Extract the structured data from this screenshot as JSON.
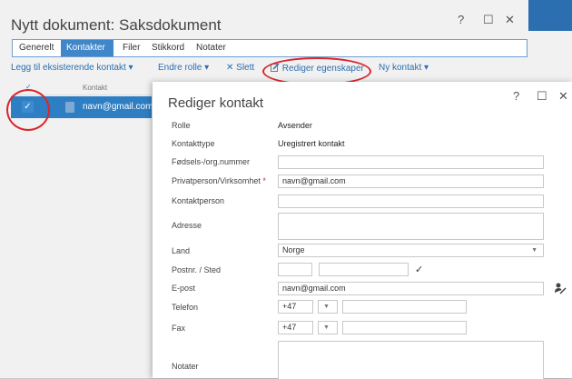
{
  "window": {
    "title": "Nytt dokument: Saksdokument",
    "help": "?",
    "maximize": "☐",
    "close": "✕"
  },
  "tabs": [
    "Generelt",
    "Kontakter",
    "Filer",
    "Stikkord",
    "Notater"
  ],
  "toolbar": {
    "add_existing": "Legg til eksisterende kontakt ▾",
    "change_role": "Endre rolle ▾",
    "delete": "✕ Slett",
    "edit_properties": "Rediger egenskaper",
    "new_contact": "Ny kontakt ▾"
  },
  "list": {
    "check_header": "✓",
    "contact_header": "Kontakt",
    "row_check": "✓",
    "row_email": "navn@gmail.com"
  },
  "dialog": {
    "title": "Rediger kontakt",
    "help": "?",
    "maximize": "☐",
    "close": "✕",
    "fields": {
      "rolle_label": "Rolle",
      "rolle_value": "Avsender",
      "type_label": "Kontakttype",
      "type_value": "Uregistrert kontakt",
      "birth_label": "Fødsels-/org.nummer",
      "birth_value": "",
      "person_label": "Privatperson/Virksomhet",
      "person_required": "*",
      "person_value": "navn@gmail.com",
      "contact_person_label": "Kontaktperson",
      "contact_person_value": "",
      "address_label": "Adresse",
      "address_value": "",
      "country_label": "Land",
      "country_value": "Norge",
      "postal_label": "Postnr. / Sted",
      "postal_code": "",
      "postal_place": "",
      "postal_check": "✓",
      "email_label": "E-post",
      "email_value": "navn@gmail.com",
      "phone_label": "Telefon",
      "phone_prefix": "+47",
      "phone_value": "",
      "fax_label": "Fax",
      "fax_prefix": "+47",
      "fax_value": "",
      "notes_label": "Notater",
      "notes_value": ""
    },
    "dropdown_arrow": "▼"
  },
  "colors": {
    "accent": "#2e7ec4",
    "annotation": "#d9262c"
  }
}
